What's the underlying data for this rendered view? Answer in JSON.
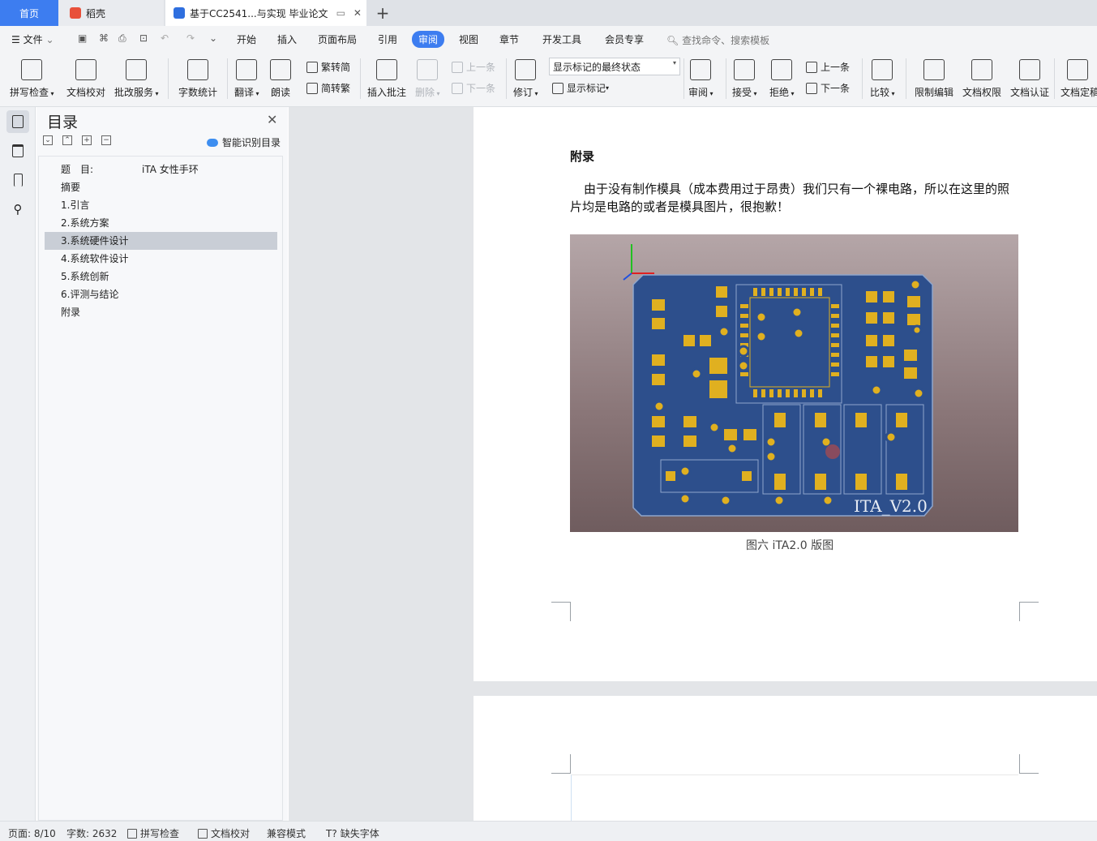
{
  "tabs": {
    "home": "首页",
    "daoke": "稻壳",
    "doc": "基于CC2541...与实现 毕业论文",
    "add": "+"
  },
  "menu": {
    "file": "文件",
    "items": [
      "开始",
      "插入",
      "页面布局",
      "引用",
      "审阅",
      "视图",
      "章节",
      "开发工具",
      "会员专享"
    ],
    "active": "审阅",
    "search": "查找命令、搜索模板"
  },
  "ribbon": {
    "spellcheck": "拼写检查",
    "doc_proof": "文档校对",
    "revise_service": "批改服务",
    "word_count": "字数统计",
    "translate": "翻译",
    "read_aloud": "朗读",
    "to_trad": "繁转简",
    "to_simp": "简转繁",
    "insert_comment": "插入批注",
    "delete": "删除",
    "prev_comment": "上一条",
    "next_comment": "下一条",
    "track": "修订",
    "markup_state": "显示标记的最终状态",
    "show_markup": "显示标记",
    "review": "审阅",
    "accept": "接受",
    "reject": "拒绝",
    "prev_change": "上一条",
    "next_change": "下一条",
    "compare": "比较",
    "restrict_edit": "限制编辑",
    "doc_permission": "文档权限",
    "doc_cert": "文档认证",
    "doc_final": "文档定稿"
  },
  "toc": {
    "title": "目录",
    "smart": "智能识别目录",
    "items": [
      "题　目:　　　　　iTA 女性手环",
      "摘要",
      "1.引言",
      "2.系统方案",
      "3.系统硬件设计",
      "4.系统软件设计",
      "5.系统创新",
      "6.评测与结论",
      "附录"
    ],
    "selected_index": 4
  },
  "document": {
    "heading": "附录",
    "paragraph": "由于没有制作模具（成本费用过于昂贵）我们只有一个裸电路，所以在这里的照片均是电路的或者是模具图片，很抱歉！",
    "board_label": "ITA_V2.0",
    "caption": "图六 iTA2.0 版图"
  },
  "status": {
    "page": "页面: 8/10",
    "words": "字数: 2632",
    "spell": "拼写检查",
    "proof": "文档校对",
    "compat": "兼容模式",
    "missing_font": "缺失字体"
  },
  "colors": {
    "accent": "#3d7df0",
    "pcb": "#2d4f8c",
    "pad": "#e0b020"
  }
}
